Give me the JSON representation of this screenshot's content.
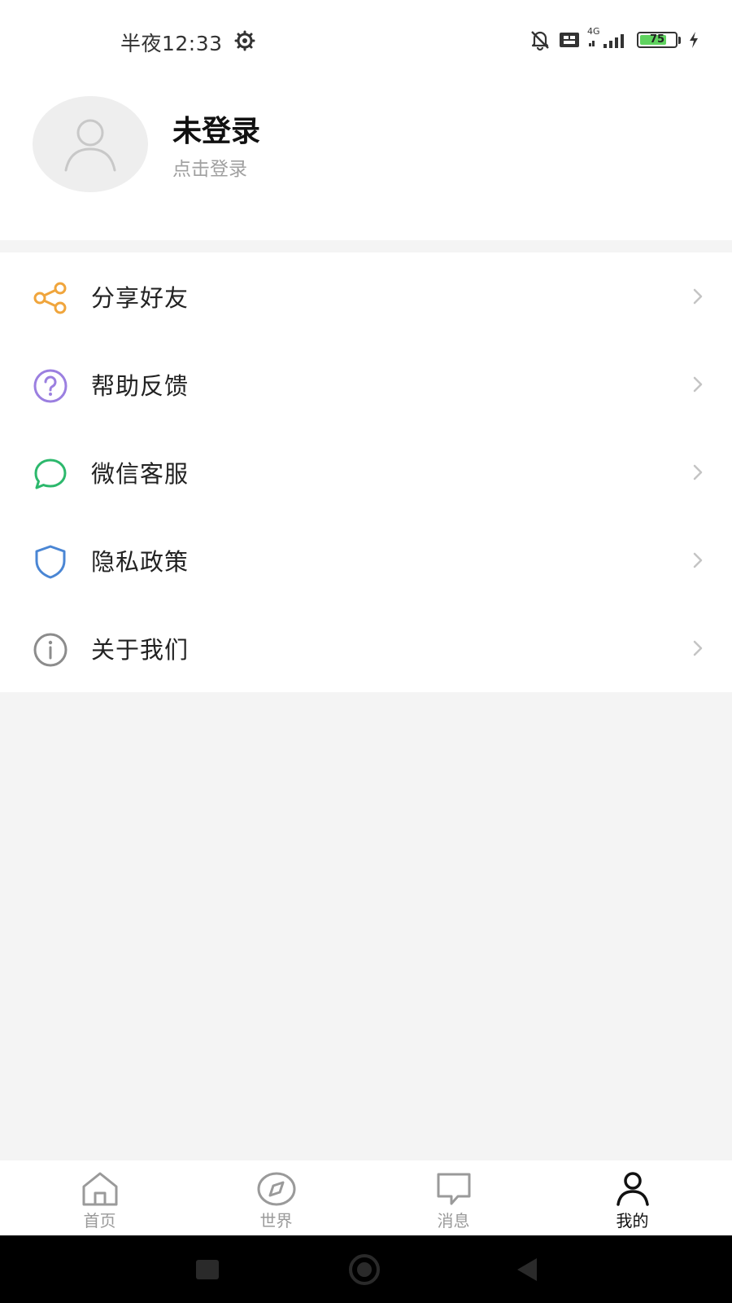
{
  "status_bar": {
    "time": "半夜12:33",
    "network": "4G",
    "battery": 75,
    "battery_text": "75"
  },
  "profile": {
    "name": "未登录",
    "subtitle": "点击登录"
  },
  "menu": {
    "items": [
      {
        "label": "分享好友",
        "icon": "share-icon",
        "color": "#f0a53c"
      },
      {
        "label": "帮助反馈",
        "icon": "question-icon",
        "color": "#9b7fe0"
      },
      {
        "label": "微信客服",
        "icon": "chat-bubble-icon",
        "color": "#2cb86c"
      },
      {
        "label": "隐私政策",
        "icon": "shield-icon",
        "color": "#4a86d4"
      },
      {
        "label": "关于我们",
        "icon": "info-icon",
        "color": "#8c8c8c"
      }
    ]
  },
  "tab_bar": {
    "tabs": [
      {
        "label": "首页",
        "icon": "home-icon"
      },
      {
        "label": "世界",
        "icon": "compass-icon"
      },
      {
        "label": "消息",
        "icon": "message-icon"
      },
      {
        "label": "我的",
        "icon": "user-icon"
      }
    ],
    "active_index": 3
  }
}
